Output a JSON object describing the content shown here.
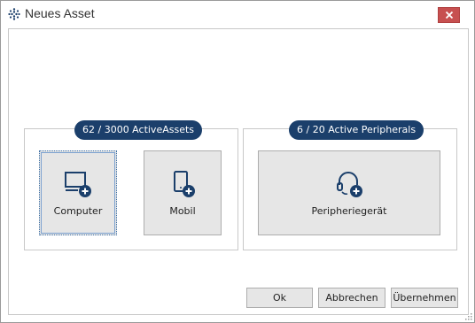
{
  "window": {
    "title": "Neues Asset",
    "app_icon": "asset-grid-icon",
    "close_icon": "close-icon"
  },
  "groups": [
    {
      "badge": "62 / 3000 ActiveAssets",
      "tiles": [
        {
          "label": "Computer",
          "icon": "computer-add-icon",
          "selected": true
        },
        {
          "label": "Mobil",
          "icon": "mobile-add-icon",
          "selected": false
        }
      ]
    },
    {
      "badge": "6 / 20 Active Peripherals",
      "tiles": [
        {
          "label": "Peripheriegerät",
          "icon": "headset-add-icon",
          "selected": false
        }
      ]
    }
  ],
  "buttons": {
    "ok": "Ok",
    "cancel": "Abbrechen",
    "apply": "Übernehmen"
  },
  "colors": {
    "badge": "#1b3f6b",
    "icon": "#1b3f6b",
    "close": "#c75050"
  }
}
